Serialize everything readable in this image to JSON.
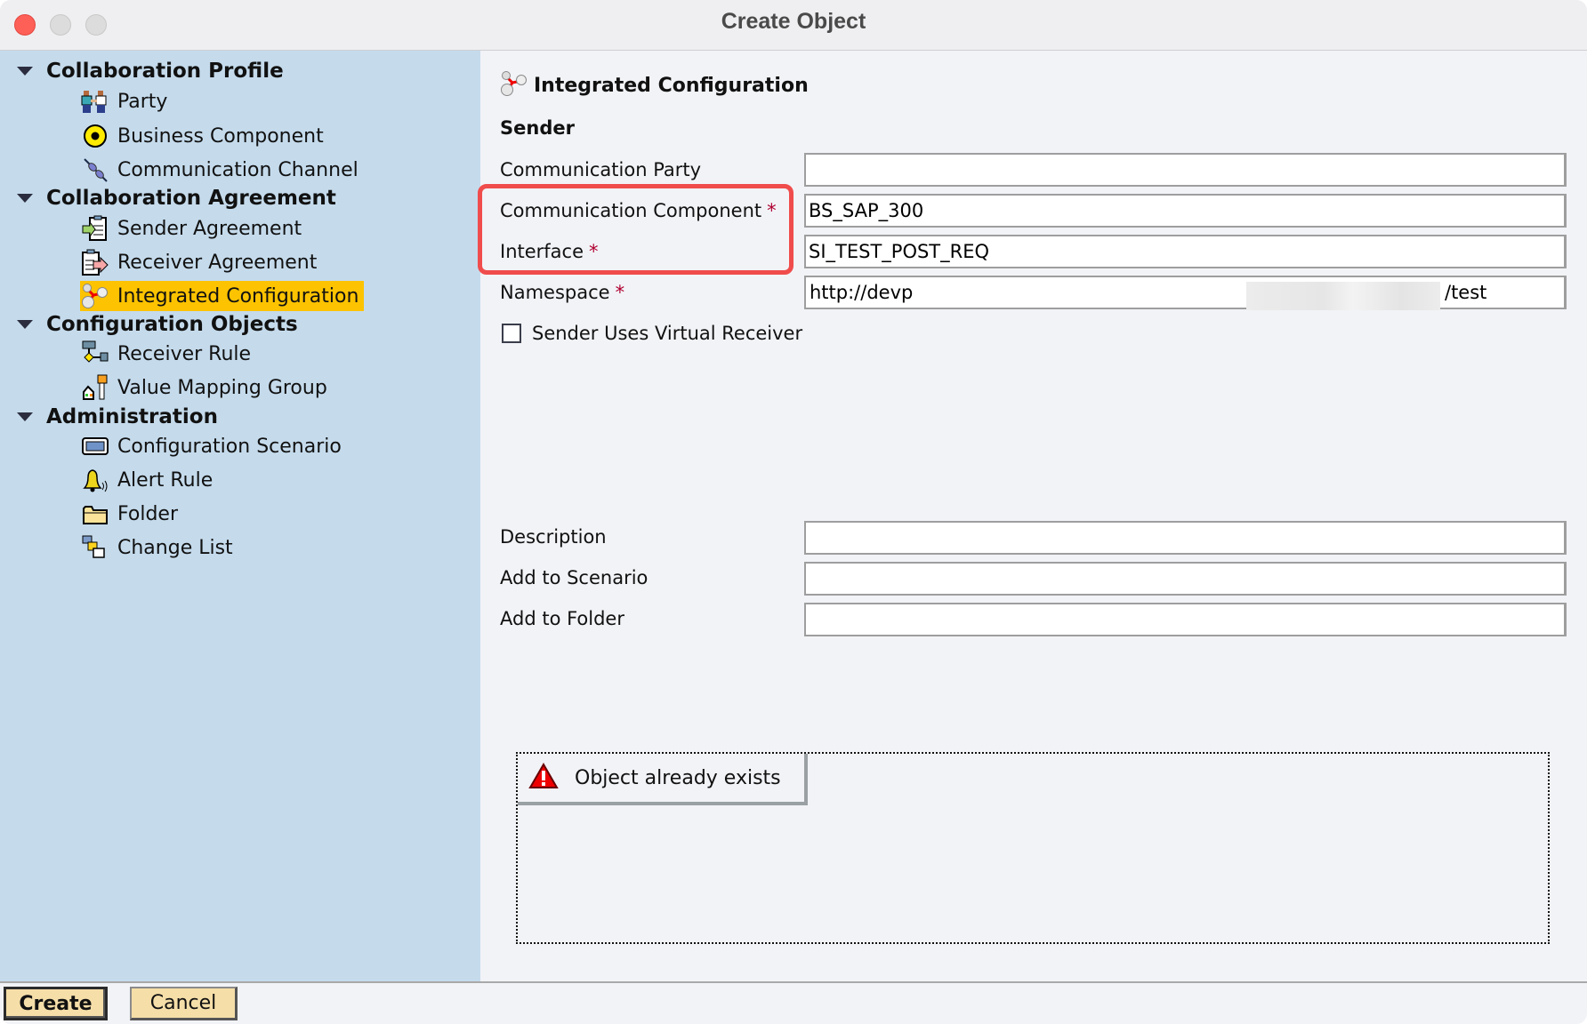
{
  "window": {
    "title": "Create Object",
    "controls": [
      "close",
      "minimize",
      "maximize"
    ]
  },
  "sidebar": {
    "groups": [
      {
        "label": "Collaboration Profile",
        "expanded": true,
        "items": [
          {
            "label": "Party",
            "icon": "party-icon"
          },
          {
            "label": "Business Component",
            "icon": "business-component-icon"
          },
          {
            "label": "Communication Channel",
            "icon": "communication-channel-icon"
          }
        ]
      },
      {
        "label": "Collaboration Agreement",
        "expanded": true,
        "items": [
          {
            "label": "Sender Agreement",
            "icon": "sender-agreement-icon"
          },
          {
            "label": "Receiver Agreement",
            "icon": "receiver-agreement-icon"
          },
          {
            "label": "Integrated Configuration",
            "icon": "integrated-configuration-icon",
            "selected": true
          }
        ]
      },
      {
        "label": "Configuration Objects",
        "expanded": true,
        "items": [
          {
            "label": "Receiver Rule",
            "icon": "receiver-rule-icon"
          },
          {
            "label": "Value Mapping Group",
            "icon": "value-mapping-group-icon"
          }
        ]
      },
      {
        "label": "Administration",
        "expanded": true,
        "items": [
          {
            "label": "Configuration Scenario",
            "icon": "configuration-scenario-icon"
          },
          {
            "label": "Alert Rule",
            "icon": "alert-rule-icon"
          },
          {
            "label": "Folder",
            "icon": "folder-icon"
          },
          {
            "label": "Change List",
            "icon": "change-list-icon"
          }
        ]
      }
    ]
  },
  "main": {
    "object_type": "Integrated Configuration",
    "section": "Sender",
    "fields": {
      "communication_party": {
        "label": "Communication Party",
        "required": false,
        "value": ""
      },
      "communication_component": {
        "label": "Communication Component",
        "required": true,
        "value": "BS_SAP_300"
      },
      "interface": {
        "label": "Interface",
        "required": true,
        "value": "SI_TEST_POST_REQ"
      },
      "namespace": {
        "label": "Namespace",
        "required": true,
        "value_prefix": "http://devp",
        "value_suffix": "/test",
        "redacted": true
      },
      "description": {
        "label": "Description",
        "value": ""
      },
      "add_to_scenario": {
        "label": "Add to Scenario",
        "value": ""
      },
      "add_to_folder": {
        "label": "Add to Folder",
        "value": ""
      }
    },
    "required_marker": "*",
    "virtual_receiver": {
      "label": "Sender Uses Virtual Receiver",
      "checked": false
    },
    "message": {
      "text": "Object already exists",
      "type": "error"
    },
    "highlight_color": "#f04c4c"
  },
  "footer": {
    "create_label": "Create",
    "cancel_label": "Cancel"
  },
  "colors": {
    "sidebar_bg": "#c5dbec",
    "selected_bg": "#fdc300",
    "button_bg": "#f5dea8",
    "required": "#b00030"
  }
}
